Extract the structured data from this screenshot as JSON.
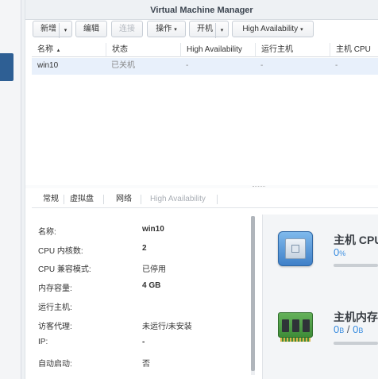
{
  "window": {
    "title": "Virtual Machine Manager"
  },
  "toolbar": {
    "create_label": "新增",
    "edit_label": "编辑",
    "connect_label": "连接",
    "action_label": "操作",
    "power_on_label": "开机",
    "ha_label": "High Availability",
    "dropdown_arrow": "▾"
  },
  "table": {
    "columns": [
      "名称",
      "状态",
      "High Availability",
      "运行主机",
      "主机 CPU"
    ],
    "sort_indicator": "▴",
    "rows": [
      {
        "name": "win10",
        "status": "已关机",
        "ha": "-",
        "host": "-",
        "host_cpu": "-"
      }
    ]
  },
  "tabs": [
    {
      "label": "常规",
      "active": true,
      "enabled": true
    },
    {
      "label": "虚拟盘",
      "active": false,
      "enabled": true
    },
    {
      "label": "网络",
      "active": false,
      "enabled": true
    },
    {
      "label": "High Availability",
      "active": false,
      "enabled": false
    }
  ],
  "details": [
    {
      "label": "名称:",
      "value": "win10",
      "bold": true
    },
    {
      "label": "CPU 内核数:",
      "value": "2",
      "bold": true
    },
    {
      "label": "CPU 兼容模式:",
      "value": "已停用",
      "bold": false
    },
    {
      "label": "内存容量:",
      "value": "4 GB",
      "bold": true
    },
    {
      "label": "运行主机:",
      "value": "",
      "bold": false
    },
    {
      "label": "访客代理:",
      "value": "未运行/未安装",
      "bold": false
    },
    {
      "label": "IP:",
      "value": "-",
      "bold": true
    },
    {
      "label": "自动启动:",
      "value": "否",
      "bold": false
    }
  ],
  "resources": {
    "cpu": {
      "title": "主机 CPU",
      "value": "0",
      "unit": "%",
      "icon": "cpu-icon"
    },
    "memory": {
      "title": "主机内存",
      "used": "0",
      "used_unit": "B",
      "slash": "/",
      "total": "0",
      "total_unit": "B",
      "icon": "memory-icon"
    }
  },
  "colors": {
    "accent": "#3b8ee0",
    "selected_row": "#e8f0fb",
    "sidebar_active": "#2e5f94"
  }
}
